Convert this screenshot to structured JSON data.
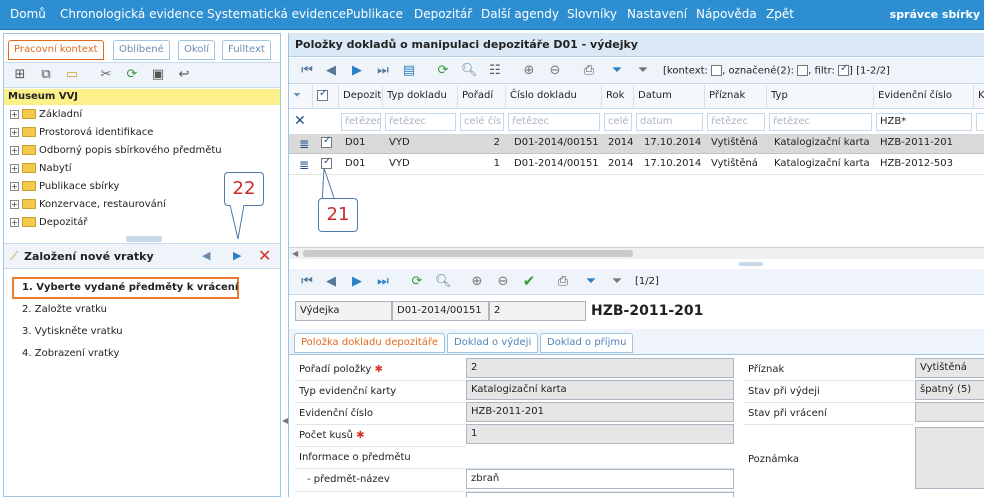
{
  "menu": [
    "Domů",
    "Chronologická evidence",
    "Systematická evidence",
    "Publikace",
    "Depozitář",
    "Další agendy",
    "Slovníky",
    "Nastavení",
    "Nápověda",
    "Zpět"
  ],
  "user": "správce sbírky",
  "left_tabs": [
    "Pracovní kontext",
    "Oblíbené",
    "Okolí",
    "Fulltext"
  ],
  "museum": "Museum VVJ",
  "tree": [
    "Základní",
    "Prostorová identifikace",
    "Odborný popis sbírkového předmětu",
    "Nabytí",
    "Publikace sbírky",
    "Konzervace, restaurování",
    "Depozitář"
  ],
  "wizard": {
    "title": "Založení nové vratky",
    "steps": [
      "1. Vyberte vydané předměty k vrácení",
      "2. Založte vratku",
      "3. Vytiskněte vratku",
      "4. Zobrazení vratky"
    ]
  },
  "callouts": {
    "c22": "22",
    "c21": "21"
  },
  "grid": {
    "title": "Položky dokladů o manipulaci depozitáře D01 - výdejky",
    "toolbar_info": {
      "kontext": "[kontext:",
      "oznacene": ", označené(2):",
      "filtr": ", filtr:",
      "range": "] [1-2/2]"
    },
    "columns": [
      "Depozit",
      "Typ dokladu",
      "Pořadí",
      "Číslo dokladu",
      "Rok",
      "Datum",
      "Příznak",
      "Typ",
      "Evidenční číslo",
      "K"
    ],
    "filter_placeholders": [
      "řetězec",
      "řetězec",
      "celé čís",
      "řetězec",
      "celé",
      "datum",
      "řetězec",
      "řetězec",
      "HZB*",
      ""
    ],
    "rows": [
      [
        "D01",
        "VYD",
        "2",
        "D01-2014/00151",
        "2014",
        "17.10.2014",
        "Vytištěná",
        "Katalogizační karta",
        "HZB-2011-201"
      ],
      [
        "D01",
        "VYD",
        "1",
        "D01-2014/00151",
        "2014",
        "17.10.2014",
        "Vytištěná",
        "Katalogizační karta",
        "HZB-2012-503"
      ]
    ]
  },
  "detail": {
    "range": "[1/2]",
    "doc_type": "Výdejka",
    "doc_number": "D01-2014/00151",
    "doc_order": "2",
    "big_id": "HZB-2011-201",
    "tabs": [
      "Položka dokladu depozitáře",
      "Doklad o výdeji",
      "Doklad o příjmu"
    ],
    "fields_left": [
      {
        "label": "Pořadí položky",
        "value": "2",
        "required": true
      },
      {
        "label": "Typ evidenční karty",
        "value": "Katalogizační karta",
        "required": false
      },
      {
        "label": "Evidenční číslo",
        "value": "HZB-2011-201",
        "required": false
      },
      {
        "label": "Počet kusů",
        "value": "1",
        "required": true
      },
      {
        "label": "Informace o předmětu",
        "value": "",
        "required": false
      },
      {
        "label": "- předmět-název",
        "value": "zbraň",
        "required": false
      }
    ],
    "fields_right": [
      {
        "label": "Příznak",
        "value": "Vytištěná"
      },
      {
        "label": "Stav při výdeji",
        "value": "špatný (5)"
      },
      {
        "label": "Stav při vrácení",
        "value": ""
      },
      {
        "label": "Poznámka",
        "value": ""
      }
    ]
  },
  "colors": {
    "menubar": "#2d8fd1",
    "accent": "#e06a1e",
    "selected_row": "#d9d9d9",
    "museum_bar": "#fbf08a"
  }
}
